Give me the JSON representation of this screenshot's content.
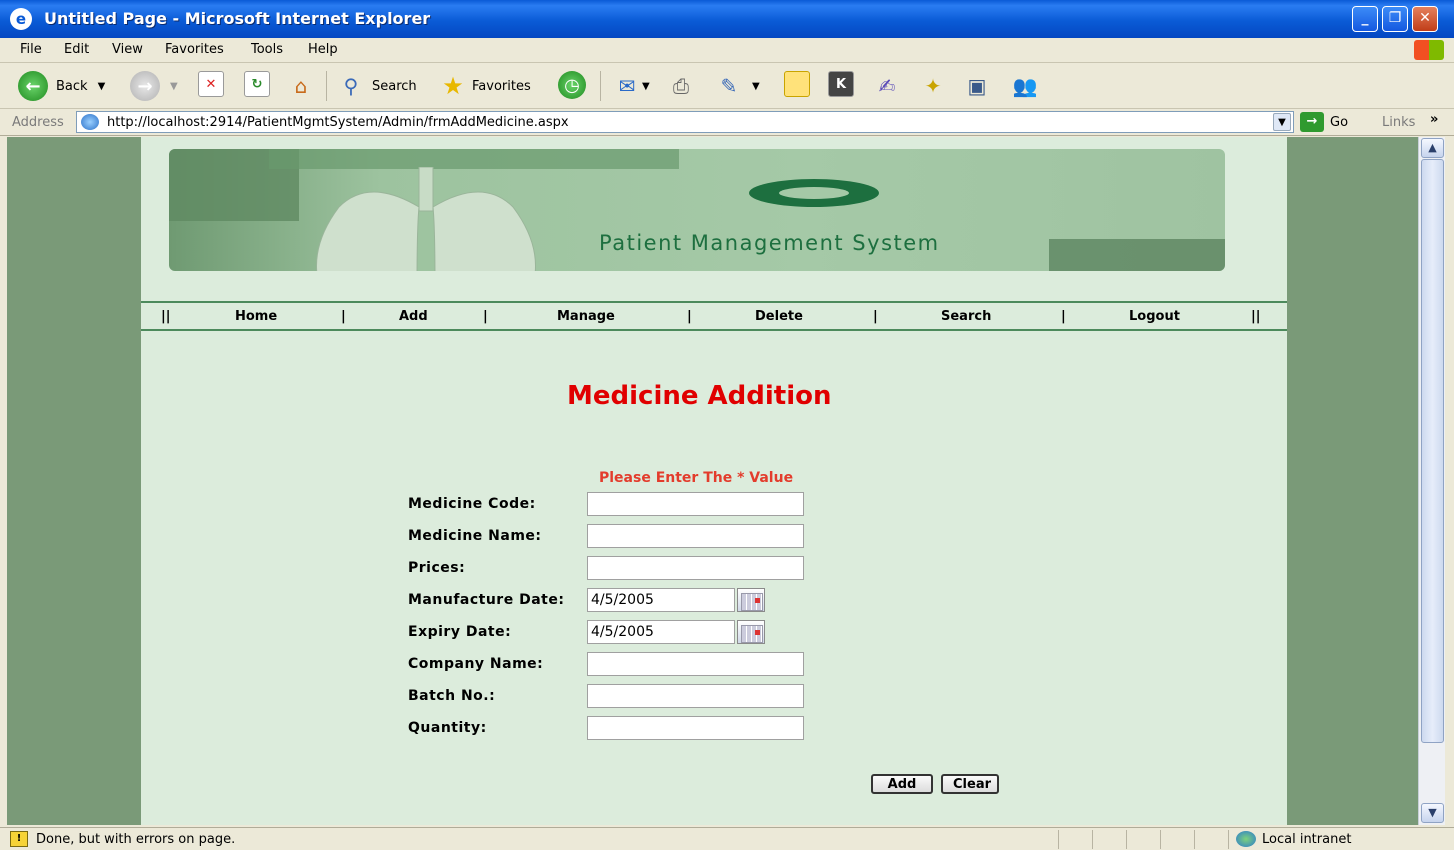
{
  "window": {
    "title": "Untitled Page - Microsoft Internet Explorer",
    "controls": [
      "_",
      "❐",
      "✕"
    ]
  },
  "menu": [
    "File",
    "Edit",
    "View",
    "Favorites",
    "Tools",
    "Help"
  ],
  "toolbar": {
    "back": "Back",
    "search": "Search",
    "favorites": "Favorites"
  },
  "address": {
    "label": "Address",
    "url": "http://localhost:2914/PatientMgmtSystem/Admin/frmAddMedicine.aspx",
    "go": "Go",
    "links": "Links",
    "more": "»"
  },
  "banner": {
    "title": "Patient Management System"
  },
  "nav": {
    "separator_start": "||",
    "separator": "|",
    "separator_end": "||",
    "items": [
      "Home",
      "Add",
      "Manage",
      "Delete",
      "Search",
      "Logout"
    ]
  },
  "form": {
    "heading": "Medicine Addition",
    "required_note": "Please Enter The * Value",
    "fields": [
      {
        "label": "Medicine Code:",
        "value": ""
      },
      {
        "label": "Medicine Name:",
        "value": ""
      },
      {
        "label": "Prices:",
        "value": ""
      },
      {
        "label": "Manufacture Date:",
        "value": "4/5/2005"
      },
      {
        "label": "Expiry Date:",
        "value": "4/5/2005"
      },
      {
        "label": "Company Name:",
        "value": ""
      },
      {
        "label": "Batch No.:",
        "value": ""
      },
      {
        "label": "Quantity:",
        "value": ""
      }
    ],
    "add_label": "Add",
    "clear_label": "Clear"
  },
  "status": {
    "message": "Done, but with errors on page.",
    "zone": "Local intranet"
  }
}
